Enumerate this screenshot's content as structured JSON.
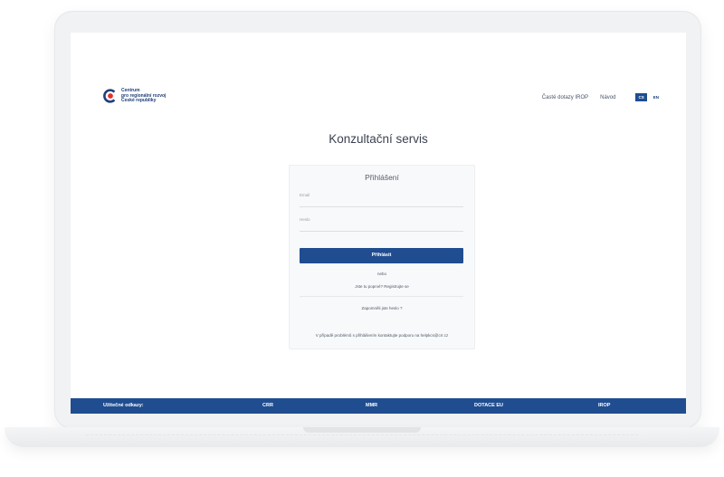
{
  "header": {
    "logo_text": "Centrum\npro regionální rozvoj\nČeské republiky",
    "nav": [
      "Časté dotazy IROP",
      "Návod"
    ],
    "languages": [
      "CS",
      "EN"
    ],
    "active_language": "CS"
  },
  "page_title": "Konzultační servis",
  "login": {
    "title": "Přihlášení",
    "email_label": "Email",
    "password_label": "Heslo",
    "submit_label": "Přihlásit",
    "or_text": "nebo",
    "register_text": "Jste tu poprvé? Registrujte se",
    "forgot_text": "Zapomněli jste heslo ?",
    "help_text": "V případě problémů s přihlášením kontaktujte podporu na helpkcs@crr.cz"
  },
  "footer": {
    "title": "Užitečné odkazy:",
    "links": [
      "CRR",
      "MMR",
      "DOTACE EU",
      "IROP"
    ]
  },
  "colors": {
    "brand_blue": "#1f4d90",
    "logo_red": "#e2312b",
    "logo_blue": "#1f3f7a"
  }
}
